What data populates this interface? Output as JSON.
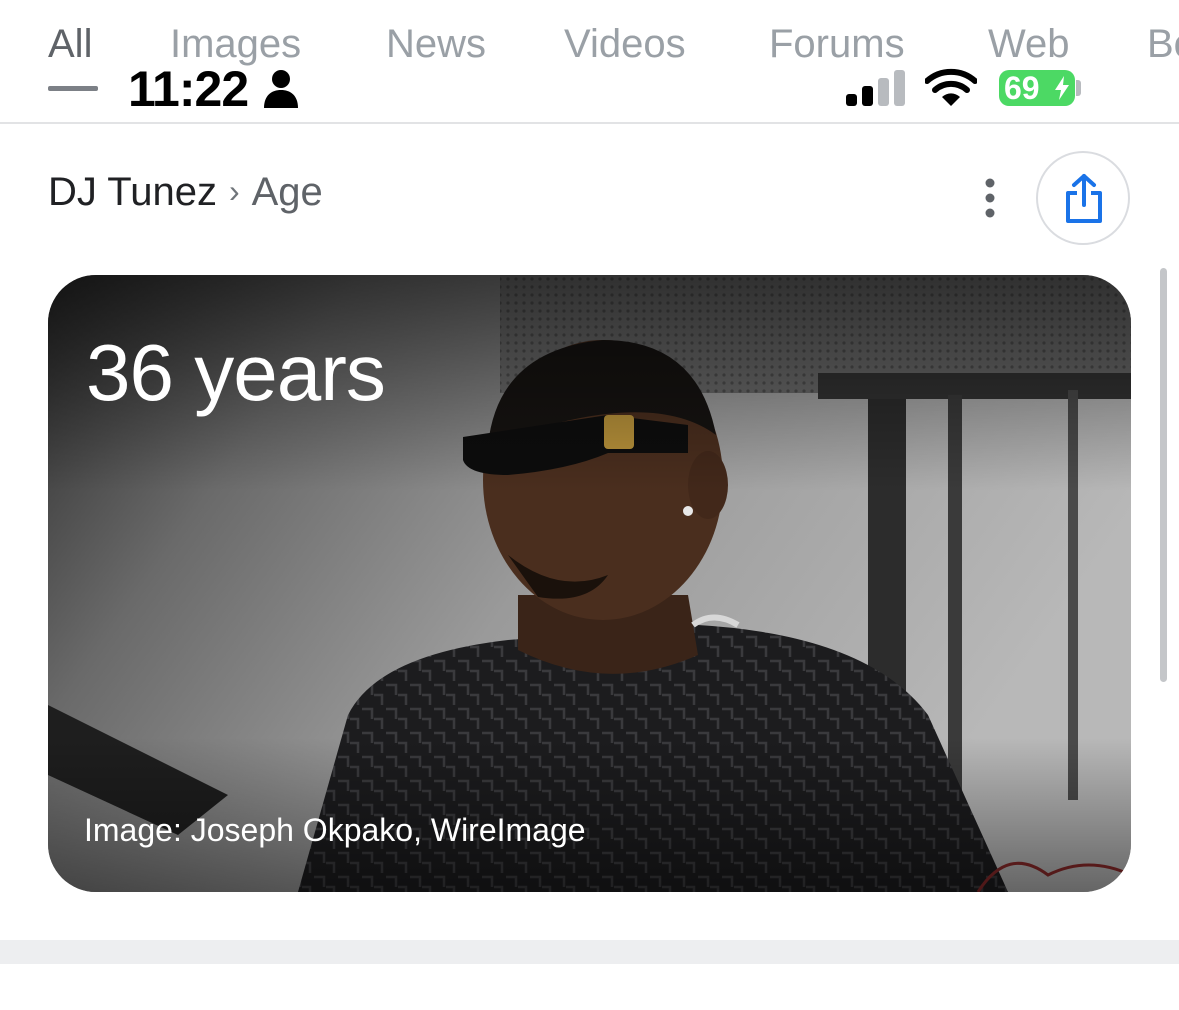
{
  "tabs": [
    {
      "label": "All",
      "active": true
    },
    {
      "label": "Images",
      "active": false
    },
    {
      "label": "News",
      "active": false
    },
    {
      "label": "Videos",
      "active": false
    },
    {
      "label": "Forums",
      "active": false
    },
    {
      "label": "Web",
      "active": false
    },
    {
      "label": "Bo",
      "active": false
    }
  ],
  "status_bar": {
    "time": "11:22",
    "battery": "69",
    "icons": [
      "person-icon",
      "signal-icon",
      "wifi-icon",
      "bolt-icon"
    ],
    "battery_color": "#4cd964"
  },
  "breadcrumb": {
    "entity": "DJ Tunez",
    "separator": "›",
    "attribute": "Age"
  },
  "actions": {
    "more_icon": "more-vert-icon",
    "share_icon": "share-icon",
    "share_color": "#1a73e8"
  },
  "card": {
    "answer": "36 years",
    "caption": "Image: Joseph Okpako, WireImage"
  }
}
